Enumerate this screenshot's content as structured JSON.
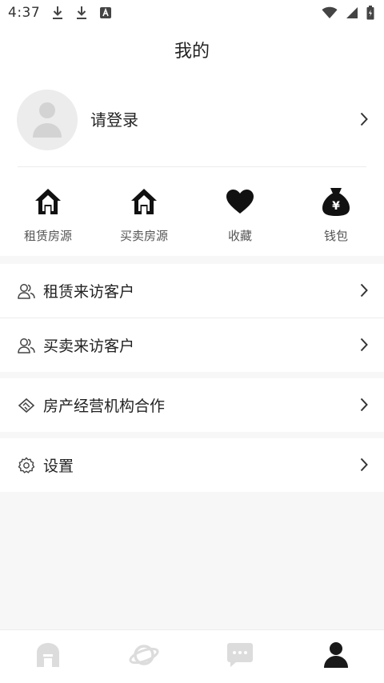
{
  "status_bar": {
    "time": "4:37",
    "icons": [
      "download-icon",
      "download-icon",
      "a-app-icon",
      "wifi-icon",
      "signal-icon",
      "battery-icon"
    ]
  },
  "header": {
    "title": "我的"
  },
  "profile": {
    "login_text": "请登录"
  },
  "quick_actions": [
    {
      "label": "租赁房源",
      "icon": "house-icon"
    },
    {
      "label": "买卖房源",
      "icon": "house-icon"
    },
    {
      "label": "收藏",
      "icon": "heart-icon"
    },
    {
      "label": "钱包",
      "icon": "money-bag-icon"
    }
  ],
  "quick_actions_wallet_symbol": "¥",
  "menu": {
    "group1": [
      {
        "label": "租赁来访客户",
        "icon": "users-icon"
      },
      {
        "label": "买卖来访客户",
        "icon": "users-icon"
      }
    ],
    "group2": [
      {
        "label": "房产经营机构合作",
        "icon": "handshake-icon"
      }
    ],
    "group3": [
      {
        "label": "设置",
        "icon": "gear-icon"
      }
    ]
  },
  "bottom_nav": [
    {
      "icon": "home-icon",
      "active": false
    },
    {
      "icon": "planet-icon",
      "active": false
    },
    {
      "icon": "message-icon",
      "active": false
    },
    {
      "icon": "profile-icon",
      "active": true
    }
  ],
  "colors": {
    "background": "#f7f7f7",
    "surface": "#ffffff",
    "text": "#222222",
    "muted": "#555555",
    "inactive_nav": "#dcdcdc",
    "active_nav": "#1a1a1a"
  }
}
